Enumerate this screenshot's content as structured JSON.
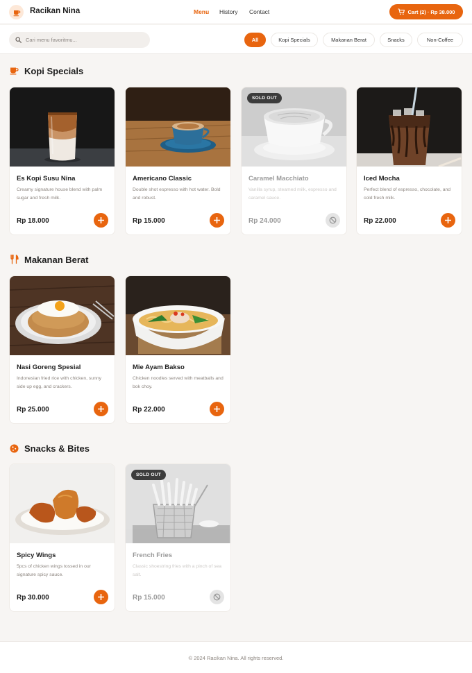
{
  "header": {
    "brand": "Racikan Nina",
    "nav": [
      "Menu",
      "History",
      "Contact"
    ],
    "cart_label": "Cart (2) · Rp 38.000"
  },
  "search": {
    "placeholder": "Cari menu favoritmu..."
  },
  "filters": [
    "All",
    "Kopi Specials",
    "Makanan Berat",
    "Snacks",
    "Non-Coffee"
  ],
  "sections": {
    "kopi": {
      "title": "Kopi Specials",
      "items": [
        {
          "name": "Es Kopi Susu Nina",
          "desc": "Creamy signature house blend with palm sugar and fresh milk.",
          "price": "Rp 18.000"
        },
        {
          "name": "Americano Classic",
          "desc": "Double shot espresso with hot water. Bold and robust.",
          "price": "Rp 15.000"
        },
        {
          "name": "Caramel Macchiato",
          "desc": "Vanilla syrup, steamed milk, espresso and caramel sauce.",
          "price": "Rp 24.000",
          "badge": "SOLD OUT"
        },
        {
          "name": "Iced Mocha",
          "desc": "Perfect blend of espresso, chocolate, and cold fresh milk.",
          "price": "Rp 22.000"
        }
      ]
    },
    "makanan": {
      "title": "Makanan Berat",
      "items": [
        {
          "name": "Nasi Goreng Spesial",
          "desc": "Indonesian fried rice with chicken, sunny side up egg, and crackers.",
          "price": "Rp 25.000"
        },
        {
          "name": "Mie Ayam Bakso",
          "desc": "Chicken noodles served with meatballs and bok choy.",
          "price": "Rp 22.000"
        }
      ]
    },
    "snacks": {
      "title": "Snacks & Bites",
      "items": [
        {
          "name": "Spicy Wings",
          "desc": "5pcs of chicken wings tossed in our signature spicy sauce.",
          "price": "Rp 30.000"
        },
        {
          "name": "French Fries",
          "desc": "Classic shoestring fries with a pinch of sea salt.",
          "price": "Rp 15.000",
          "badge": "SOLD OUT"
        }
      ]
    }
  },
  "footer": {
    "text": "© 2024 Racikan Nina. All rights reserved."
  },
  "colors": {
    "accent": "#e8650f",
    "background": "#f7f5f3",
    "card": "#ffffff",
    "sold_badge": "#3c3c3c"
  }
}
